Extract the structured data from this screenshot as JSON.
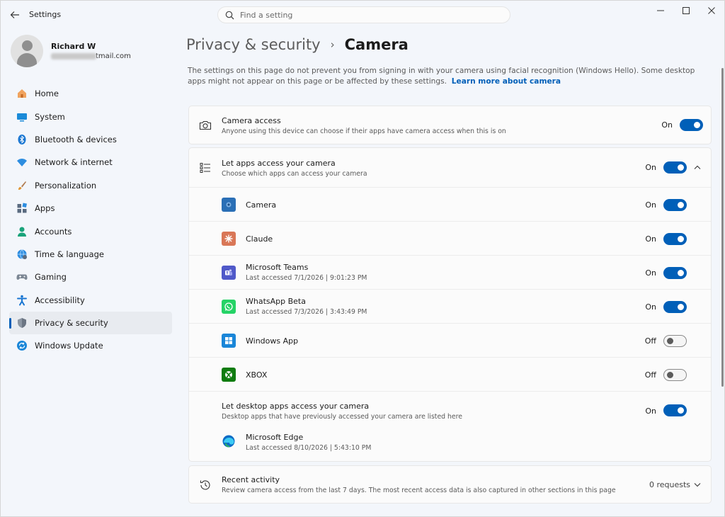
{
  "window": {
    "app_title": "Settings",
    "search_placeholder": "Find a setting"
  },
  "profile": {
    "name": "Richard W",
    "email_suffix": "tmail.com"
  },
  "sidebar": {
    "items": [
      {
        "label": "Home",
        "icon": "home-icon"
      },
      {
        "label": "System",
        "icon": "system-icon"
      },
      {
        "label": "Bluetooth & devices",
        "icon": "bluetooth-icon"
      },
      {
        "label": "Network & internet",
        "icon": "wifi-icon"
      },
      {
        "label": "Personalization",
        "icon": "brush-icon"
      },
      {
        "label": "Apps",
        "icon": "apps-icon"
      },
      {
        "label": "Accounts",
        "icon": "accounts-icon"
      },
      {
        "label": "Time & language",
        "icon": "globe-icon"
      },
      {
        "label": "Gaming",
        "icon": "gamepad-icon"
      },
      {
        "label": "Accessibility",
        "icon": "accessibility-icon"
      },
      {
        "label": "Privacy & security",
        "icon": "shield-icon",
        "active": true
      },
      {
        "label": "Windows Update",
        "icon": "update-icon"
      }
    ]
  },
  "breadcrumb": {
    "parent": "Privacy & security",
    "separator": "›",
    "current": "Camera"
  },
  "description": {
    "text": "The settings on this page do not prevent you from signing in with your camera using facial recognition (Windows Hello). Some desktop apps might not appear on this page or be affected by these settings.",
    "link": "Learn more about camera"
  },
  "camera_access": {
    "title": "Camera access",
    "subtitle": "Anyone using this device can choose if their apps have camera access when this is on",
    "state": "On"
  },
  "let_apps": {
    "title": "Let apps access your camera",
    "subtitle": "Choose which apps can access your camera",
    "state": "On"
  },
  "apps": [
    {
      "name": "Camera",
      "last": "",
      "state": "On",
      "icon": "camera-app-icon",
      "color": "#2a6fb6"
    },
    {
      "name": "Claude",
      "last": "",
      "state": "On",
      "icon": "claude-app-icon",
      "color": "#d97757"
    },
    {
      "name": "Microsoft Teams",
      "last": "Last accessed 7/1/2026  |  9:01:23 PM",
      "state": "On",
      "icon": "teams-app-icon",
      "color": "#5059c9"
    },
    {
      "name": "WhatsApp Beta",
      "last": "Last accessed 7/3/2026  |  3:43:49 PM",
      "state": "On",
      "icon": "whatsapp-app-icon",
      "color": "#25d366"
    },
    {
      "name": "Windows App",
      "last": "",
      "state": "Off",
      "icon": "windows-app-icon",
      "color": "#1a86d8"
    },
    {
      "name": "XBOX",
      "last": "",
      "state": "Off",
      "icon": "xbox-app-icon",
      "color": "#107c10"
    }
  ],
  "desktop_apps": {
    "title": "Let desktop apps access your camera",
    "subtitle": "Desktop apps that have previously accessed your camera are listed here",
    "state": "On",
    "app_name": "Microsoft Edge",
    "app_last": "Last accessed 8/10/2026  |  5:43:10 PM"
  },
  "recent_activity": {
    "title": "Recent activity",
    "subtitle": "Review camera access from the last 7 days. The most recent access data is also captured in other sections in this page",
    "requests": "0 requests"
  },
  "colors": {
    "accent": "#005fb8"
  }
}
